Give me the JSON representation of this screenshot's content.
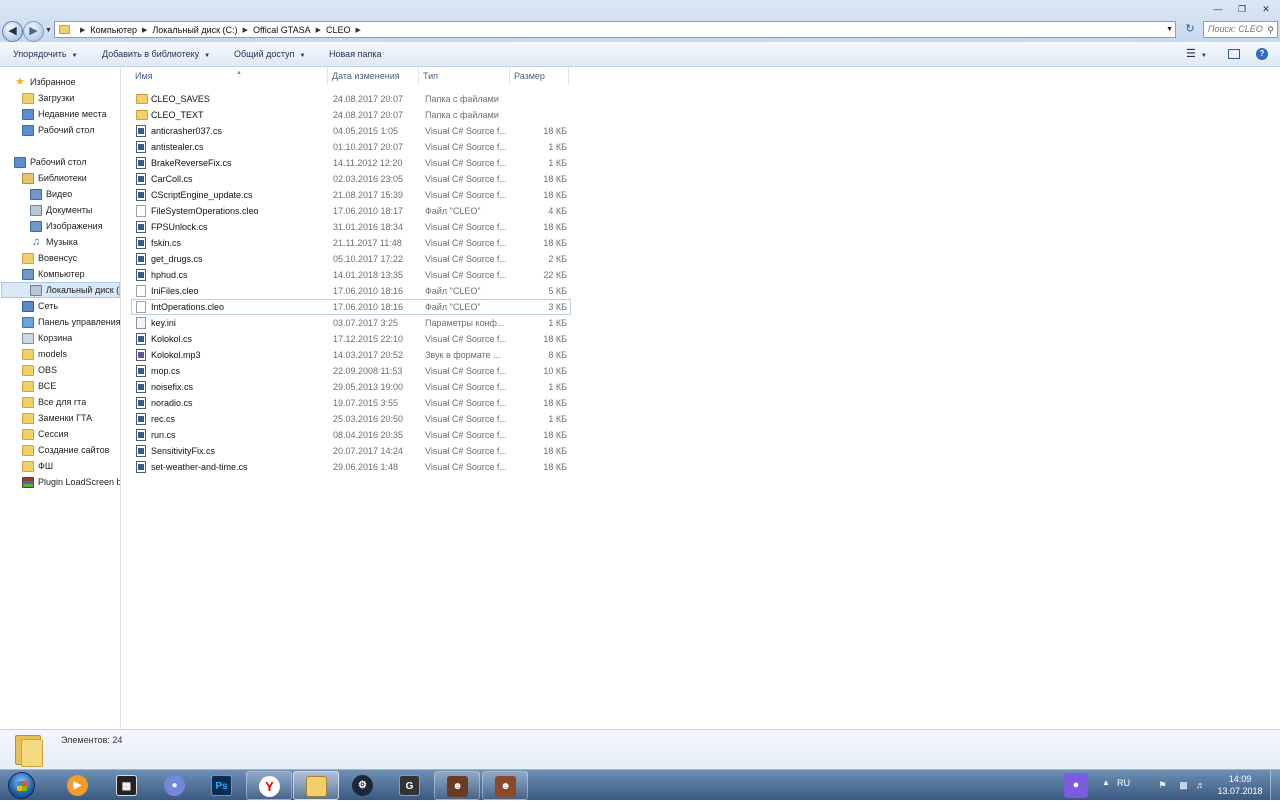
{
  "address": {
    "crumbs": [
      "Компьютер",
      "Локальный диск (C:)",
      "Offical GTASA",
      "CLEO"
    ],
    "search_placeholder": "Поиск: CLEO"
  },
  "toolbar": {
    "organize": "Упорядочить",
    "library": "Добавить в библиотеку",
    "share": "Общий доступ",
    "new_folder": "Новая папка"
  },
  "nav": {
    "favorites": "Избранное",
    "downloads": "Загрузки",
    "recent": "Недавние места",
    "desktop_fav": "Рабочий стол",
    "desktop": "Рабочий стол",
    "libraries": "Библиотеки",
    "video": "Видео",
    "documents": "Документы",
    "images": "Изображения",
    "music": "Музыка",
    "user": "Вовенсус",
    "computer": "Компьютер",
    "local_disk": "Локальный диск (",
    "network": "Сеть",
    "control_panel": "Панель управления",
    "recycle": "Корзина",
    "models": "models",
    "obs": "OBS",
    "all": "ВСЕ",
    "for_gta": "Все для гта",
    "gta_replace": "Заменки ГТА",
    "session": "Сессия",
    "sites": "Создание сайтов",
    "fsh": "ФШ",
    "plugin": "Plugin LoadScreen b"
  },
  "columns": {
    "name": "Имя",
    "date": "Дата изменения",
    "type": "Тип",
    "size": "Размер"
  },
  "files": [
    {
      "name": "CLEO_SAVES",
      "date": "24.08.2017 20:07",
      "type": "Папка с файлами",
      "size": "",
      "icon": "folder"
    },
    {
      "name": "CLEO_TEXT",
      "date": "24.08.2017 20:07",
      "type": "Папка с файлами",
      "size": "",
      "icon": "folder"
    },
    {
      "name": "anticrasher037.cs",
      "date": "04.05.2015 1:05",
      "type": "Visual C# Source f...",
      "size": "18 КБ",
      "icon": "cs"
    },
    {
      "name": "antistealer.cs",
      "date": "01.10.2017 20:07",
      "type": "Visual C# Source f...",
      "size": "1 КБ",
      "icon": "cs"
    },
    {
      "name": "BrakeReverseFix.cs",
      "date": "14.11.2012 12:20",
      "type": "Visual C# Source f...",
      "size": "1 КБ",
      "icon": "cs"
    },
    {
      "name": "CarColl.cs",
      "date": "02.03.2016 23:05",
      "type": "Visual C# Source f...",
      "size": "18 КБ",
      "icon": "cs"
    },
    {
      "name": "CScriptEngine_update.cs",
      "date": "21.08.2017 15:39",
      "type": "Visual C# Source f...",
      "size": "18 КБ",
      "icon": "cs"
    },
    {
      "name": "FileSystemOperations.cleo",
      "date": "17.06.2010 18:17",
      "type": "Файл \"CLEO\"",
      "size": "4 КБ",
      "icon": "generic"
    },
    {
      "name": "FPSUnlock.cs",
      "date": "31.01.2016 18:34",
      "type": "Visual C# Source f...",
      "size": "18 КБ",
      "icon": "cs"
    },
    {
      "name": "fskin.cs",
      "date": "21.11.2017 11:48",
      "type": "Visual C# Source f...",
      "size": "18 КБ",
      "icon": "cs"
    },
    {
      "name": "get_drugs.cs",
      "date": "05.10.2017 17:22",
      "type": "Visual C# Source f...",
      "size": "2 КБ",
      "icon": "cs"
    },
    {
      "name": "hphud.cs",
      "date": "14.01.2018 13:35",
      "type": "Visual C# Source f...",
      "size": "22 КБ",
      "icon": "cs"
    },
    {
      "name": "IniFiles.cleo",
      "date": "17.06.2010 18:16",
      "type": "Файл \"CLEO\"",
      "size": "5 КБ",
      "icon": "generic"
    },
    {
      "name": "IntOperations.cleo",
      "date": "17.06.2010 18:16",
      "type": "Файл \"CLEO\"",
      "size": "3 КБ",
      "icon": "generic"
    },
    {
      "name": "key.ini",
      "date": "03.07.2017 3:25",
      "type": "Параметры конф...",
      "size": "1 КБ",
      "icon": "ini"
    },
    {
      "name": "Kolokol.cs",
      "date": "17.12.2015 22:10",
      "type": "Visual C# Source f...",
      "size": "18 КБ",
      "icon": "cs"
    },
    {
      "name": "Kolokol.mp3",
      "date": "14.03.2017 20:52",
      "type": "Звук в формате ...",
      "size": "8 КБ",
      "icon": "mp3"
    },
    {
      "name": "mop.cs",
      "date": "22.09.2008 11:53",
      "type": "Visual C# Source f...",
      "size": "10 КБ",
      "icon": "cs"
    },
    {
      "name": "noisefix.cs",
      "date": "29.05.2013 19:00",
      "type": "Visual C# Source f...",
      "size": "1 КБ",
      "icon": "cs"
    },
    {
      "name": "noradio.cs",
      "date": "19.07.2015 3:55",
      "type": "Visual C# Source f...",
      "size": "18 КБ",
      "icon": "cs"
    },
    {
      "name": "rec.cs",
      "date": "25.03.2016 20:50",
      "type": "Visual C# Source f...",
      "size": "1 КБ",
      "icon": "cs"
    },
    {
      "name": "run.cs",
      "date": "08.04.2016 20:35",
      "type": "Visual C# Source f...",
      "size": "18 КБ",
      "icon": "cs"
    },
    {
      "name": "SensitivityFix.cs",
      "date": "20.07.2017 14:24",
      "type": "Visual C# Source f...",
      "size": "18 КБ",
      "icon": "cs"
    },
    {
      "name": "set-weather-and-time.cs",
      "date": "29.06.2016 1:48",
      "type": "Visual C# Source f...",
      "size": "18 КБ",
      "icon": "cs"
    }
  ],
  "selected_file": "IntOperations.cleo",
  "details": {
    "count": "Элементов: 24"
  },
  "tray": {
    "lang": "RU",
    "time": "14:09",
    "date": "13.07.2018"
  },
  "taskbar_apps": [
    "media-player",
    "video-editor",
    "discord",
    "photoshop",
    "yandex-browser",
    "explorer",
    "steam",
    "gta-sa",
    "samp-1",
    "samp-2"
  ]
}
